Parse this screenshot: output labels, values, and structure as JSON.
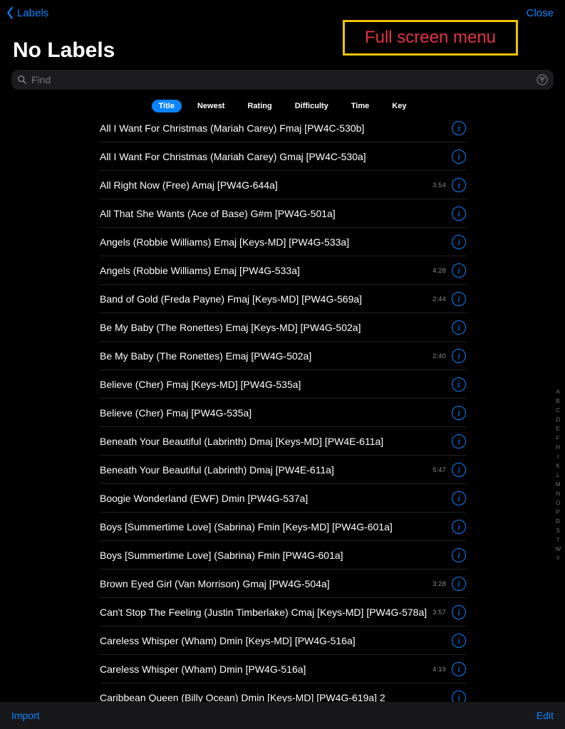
{
  "header": {
    "back_label": "Labels",
    "close_label": "Close"
  },
  "annotation": "Full screen menu",
  "page_title": "No Labels",
  "search": {
    "placeholder": "Find"
  },
  "sorts": [
    {
      "label": "Title",
      "active": true
    },
    {
      "label": "Newest",
      "active": false
    },
    {
      "label": "Rating",
      "active": false
    },
    {
      "label": "Difficulty",
      "active": false
    },
    {
      "label": "Time",
      "active": false
    },
    {
      "label": "Key",
      "active": false
    }
  ],
  "songs": [
    {
      "title": "All I Want For Christmas (Mariah Carey) Fmaj [PW4C-530b]",
      "time": ""
    },
    {
      "title": "All I Want For Christmas (Mariah Carey) Gmaj [PW4C-530a]",
      "time": ""
    },
    {
      "title": "All Right Now (Free) Amaj [PW4G-644a]",
      "time": "3:54"
    },
    {
      "title": "All That She Wants (Ace of Base) G#m [PW4G-501a]",
      "time": ""
    },
    {
      "title": "Angels (Robbie Williams) Emaj [Keys-MD] [PW4G-533a]",
      "time": ""
    },
    {
      "title": "Angels (Robbie Williams) Emaj [PW4G-533a]",
      "time": "4:28"
    },
    {
      "title": "Band of Gold (Freda Payne) Fmaj [Keys-MD] [PW4G-569a]",
      "time": "2:44"
    },
    {
      "title": "Be My Baby (The Ronettes) Emaj [Keys-MD] [PW4G-502a]",
      "time": ""
    },
    {
      "title": "Be My Baby (The Ronettes) Emaj [PW4G-502a]",
      "time": "2:40"
    },
    {
      "title": "Believe (Cher) Fmaj [Keys-MD] [PW4G-535a]",
      "time": ""
    },
    {
      "title": "Believe (Cher) Fmaj [PW4G-535a]",
      "time": ""
    },
    {
      "title": "Beneath Your Beautiful (Labrinth) Dmaj [Keys-MD] [PW4E-611a]",
      "time": ""
    },
    {
      "title": "Beneath Your Beautiful (Labrinth) Dmaj [PW4E-611a]",
      "time": "5:47"
    },
    {
      "title": "Boogie Wonderland (EWF) Dmin [PW4G-537a]",
      "time": ""
    },
    {
      "title": "Boys [Summertime Love] (Sabrina) Fmin [Keys-MD] [PW4G-601a]",
      "time": ""
    },
    {
      "title": "Boys [Summertime Love] (Sabrina) Fmin [PW4G-601a]",
      "time": ""
    },
    {
      "title": "Brown Eyed Girl (Van Morrison) Gmaj [PW4G-504a]",
      "time": "3:28"
    },
    {
      "title": "Can't Stop The Feeling (Justin Timberlake) Cmaj [Keys-MD] [PW4G-578a]",
      "time": "3:57"
    },
    {
      "title": "Careless Whisper (Wham) Dmin [Keys-MD] [PW4G-516a]",
      "time": ""
    },
    {
      "title": "Careless Whisper (Wham) Dmin [PW4G-516a]",
      "time": "4:19"
    },
    {
      "title": "Caribbean Queen (Billy Ocean) Dmin [Keys-MD] [PW4G-619a] 2",
      "time": ""
    }
  ],
  "index_letters": [
    "A",
    "B",
    "C",
    "D",
    "E",
    "F",
    "H",
    "I",
    "K",
    "L",
    "M",
    "N",
    "O",
    "P",
    "R",
    "S",
    "T",
    "W",
    "Y"
  ],
  "toolbar": {
    "import_label": "Import",
    "edit_label": "Edit"
  }
}
